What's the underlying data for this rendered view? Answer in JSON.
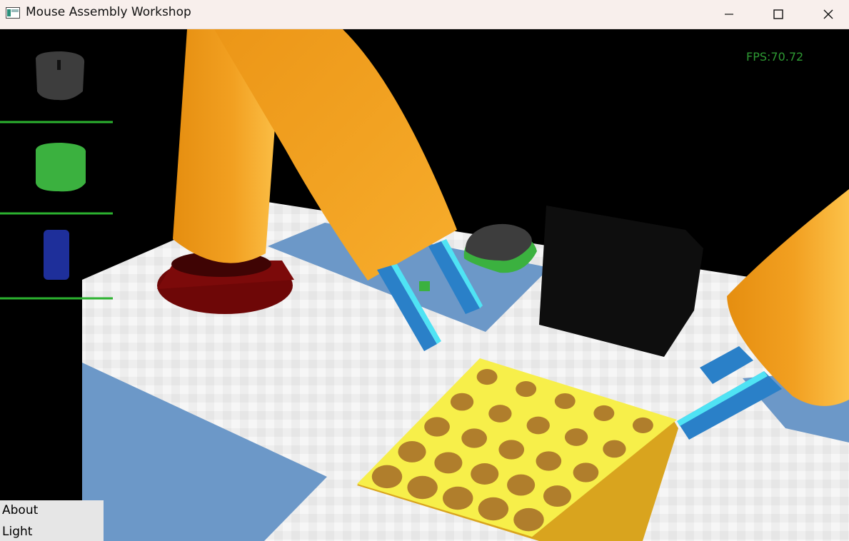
{
  "window": {
    "title": "Mouse Assembly Workshop",
    "controls": [
      "minimize",
      "maximize",
      "close"
    ]
  },
  "hud": {
    "fps_text": "FPS:70.72"
  },
  "parts_palette": [
    {
      "name": "mouse-top-shell",
      "color": "#3d3d3d"
    },
    {
      "name": "mouse-base-shell",
      "color": "#3bb13f"
    },
    {
      "name": "mouse-wheel-cylinder",
      "color": "#1e2f9a"
    }
  ],
  "menu": {
    "items": [
      "About",
      "Light"
    ]
  },
  "colors": {
    "robot_arm": "#f0a020",
    "robot_base": "#7a0a0a",
    "gripper": "#2a80c8",
    "tray": "#f7ef4a",
    "tray_holes": "#b07e2c",
    "table": "#eeeeee",
    "floor": "#6c98c8",
    "separator": "#2bb22f"
  }
}
